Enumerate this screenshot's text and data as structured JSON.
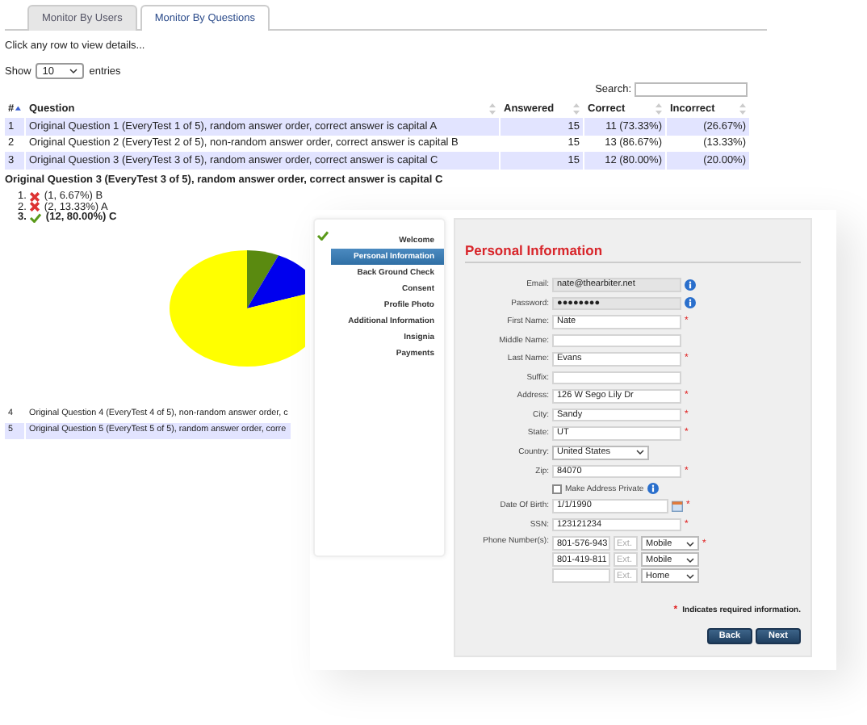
{
  "tabs": [
    {
      "label": "Monitor By Users",
      "selected": false
    },
    {
      "label": "Monitor By Questions",
      "selected": true
    }
  ],
  "instructions": "Click any row to view details...",
  "entries": {
    "before": "Show",
    "value": "10",
    "after": "entries"
  },
  "search": {
    "label": "Search:"
  },
  "table": {
    "columns": [
      {
        "label": "#",
        "sorted": true
      },
      {
        "label": "Question",
        "sorted": false
      },
      {
        "label": "Answered",
        "sorted": false
      },
      {
        "label": "Correct",
        "sorted": false
      },
      {
        "label": "Incorrect",
        "sorted": false
      }
    ],
    "rows": [
      {
        "cells": [
          "1",
          "Original Question 1 (EveryTest 1 of 5), random answer order, correct answer is capital A",
          "15",
          "11 (73.33%)",
          "(26.67%)"
        ]
      },
      {
        "cells": [
          "2",
          "Original Question 2 (EveryTest 2 of 5), non-random answer order, correct answer is capital B",
          "15",
          "13 (86.67%)",
          "(13.33%)"
        ]
      },
      {
        "cells": [
          "3",
          "Original Question 3 (EveryTest 3 of 5), random answer order, correct answer is capital C",
          "15",
          "12 (80.00%)",
          "(20.00%)"
        ]
      }
    ]
  },
  "detail": {
    "title": "Original Question 3 (EveryTest 3 of 5), random answer order, correct answer is capital C",
    "answers": [
      {
        "number": "1.",
        "text": "(1, 6.67%) B",
        "correct": false
      },
      {
        "number": "2.",
        "text": "(2, 13.33%) A",
        "correct": false
      },
      {
        "number": "3.",
        "text": "(12, 80.00%) C",
        "correct": true
      }
    ]
  },
  "more_rows": [
    {
      "cells": [
        "4",
        "Original Question 4 (EveryTest 4 of 5), non-random answer order, c"
      ]
    },
    {
      "cells": [
        "5",
        "Original Question 5 (EveryTest 5 of 5), random answer order, corre"
      ]
    }
  ],
  "wizard": {
    "steps": [
      {
        "label": "Welcome",
        "selected": false,
        "done": true
      },
      {
        "label": "Personal Information",
        "selected": true,
        "done": false
      },
      {
        "label": "Back Ground Check",
        "selected": false,
        "done": false
      },
      {
        "label": "Consent",
        "selected": false,
        "done": false
      },
      {
        "label": "Profile Photo",
        "selected": false,
        "done": false
      },
      {
        "label": "Additional Information",
        "selected": false,
        "done": false
      },
      {
        "label": "Insignia",
        "selected": false,
        "done": false
      },
      {
        "label": "Payments",
        "selected": false,
        "done": false
      }
    ],
    "form": {
      "title": "Personal Information",
      "required_mark": "*",
      "fields": [
        {
          "kind": "text",
          "label": "Email:",
          "value": "nate@thearbiter.net",
          "required": false,
          "disabled": true,
          "info": true
        },
        {
          "kind": "text",
          "label": "Password:",
          "value": "●●●●●●●●",
          "required": false,
          "disabled": true,
          "info": true
        },
        {
          "kind": "text",
          "label": "First Name:",
          "value": "Nate",
          "required": true,
          "disabled": false,
          "info": false
        },
        {
          "kind": "text",
          "label": "Middle Name:",
          "required": false,
          "disabled": false,
          "info": false
        },
        {
          "kind": "text",
          "label": "Last Name:",
          "value": "Evans",
          "required": true,
          "disabled": false,
          "info": false
        },
        {
          "kind": "text",
          "label": "Suffix:",
          "required": false,
          "disabled": false,
          "info": false
        },
        {
          "kind": "text",
          "label": "Address:",
          "value": "126 W Sego Lily Dr",
          "required": true,
          "disabled": false,
          "info": false
        },
        {
          "kind": "text",
          "label": "City:",
          "value": "Sandy",
          "required": true,
          "disabled": false,
          "info": false
        },
        {
          "kind": "text",
          "label": "State:",
          "value": "UT",
          "required": true,
          "disabled": false,
          "info": false
        },
        {
          "kind": "select",
          "label": "Country:",
          "value": "United States",
          "required": false
        },
        {
          "kind": "text",
          "label": "Zip:",
          "value": "84070",
          "required": true,
          "disabled": false,
          "info": false
        },
        {
          "kind": "checkbox",
          "label": "Make Address Private",
          "checked": false,
          "info": true
        },
        {
          "kind": "date",
          "label": "Date Of Birth:",
          "value": "1/1/1990",
          "required": true
        },
        {
          "kind": "text",
          "label": "SSN:",
          "value": "123121234",
          "required": true,
          "disabled": false,
          "info": false
        },
        {
          "kind": "phones",
          "label": "Phone Number(s):",
          "required": true,
          "phones": [
            {
              "number": "801-576-943",
              "ext": "Ext.",
              "type": "Mobile"
            },
            {
              "number": "801-419-811",
              "ext": "Ext.",
              "type": "Mobile"
            },
            {
              "ext": "Ext.",
              "type": "Home"
            }
          ]
        }
      ]
    },
    "required_note": "Indicates required information.",
    "buttons": [
      "Back",
      "Next"
    ]
  }
}
